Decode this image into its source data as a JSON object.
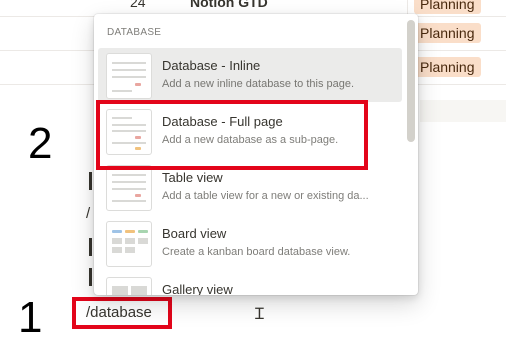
{
  "background": {
    "rows": [
      {
        "num": "24",
        "name": "Notion GTD",
        "tag": "Planning"
      },
      {
        "num": "",
        "name": "",
        "tag": "Planning"
      },
      {
        "num": "",
        "name": "",
        "tag": "Planning"
      }
    ],
    "slash": "/"
  },
  "menu": {
    "header": "DATABASE",
    "items": [
      {
        "title": "Database - Inline",
        "desc": "Add a new inline database to this page.",
        "icon": "database-inline-icon"
      },
      {
        "title": "Database - Full page",
        "desc": "Add a new database as a sub-page.",
        "icon": "database-fullpage-icon"
      },
      {
        "title": "Table view",
        "desc": "Add a table view for a new or existing da...",
        "icon": "table-view-icon"
      },
      {
        "title": "Board view",
        "desc": "Create a kanban board database view.",
        "icon": "board-view-icon"
      },
      {
        "title": "Gallery view",
        "desc": "",
        "icon": "gallery-view-icon"
      }
    ],
    "selected_index": 0
  },
  "editor": {
    "command_text": "/database",
    "cursor": "Ɪ"
  },
  "annotations": {
    "step1": "1",
    "step2": "2",
    "highlight_color": "#e3051a"
  },
  "colors": {
    "tag_bg": "#fadec9",
    "tag_text": "#49290e",
    "menu_selected": "#ebebea"
  }
}
